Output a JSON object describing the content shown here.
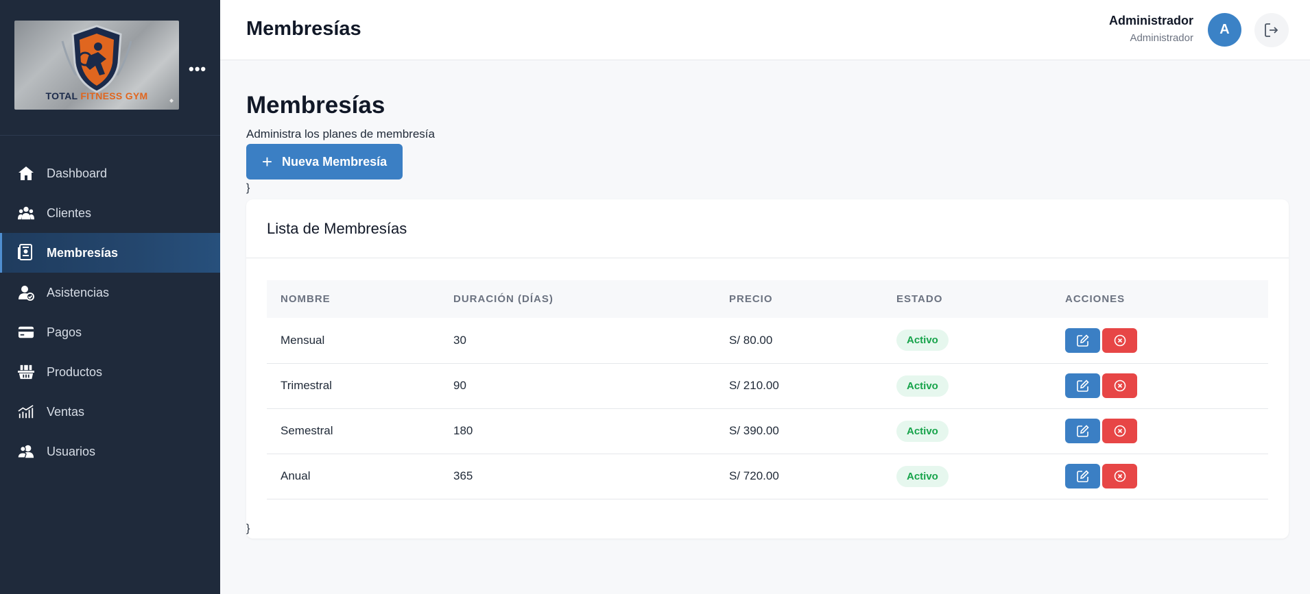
{
  "brand": {
    "logo_text_main": "TOTAL",
    "logo_text_accent": "FITNESS GYM",
    "more_label": "•••"
  },
  "sidebar": {
    "items": [
      {
        "label": "Dashboard",
        "icon": "home-icon"
      },
      {
        "label": "Clientes",
        "icon": "users-group-icon"
      },
      {
        "label": "Membresías",
        "icon": "membership-card-icon",
        "active": true
      },
      {
        "label": "Asistencias",
        "icon": "user-check-icon"
      },
      {
        "label": "Pagos",
        "icon": "credit-card-icon"
      },
      {
        "label": "Productos",
        "icon": "basket-icon"
      },
      {
        "label": "Ventas",
        "icon": "chart-line-icon"
      },
      {
        "label": "Usuarios",
        "icon": "users-icon"
      }
    ]
  },
  "header": {
    "title": "Membresías",
    "user_name": "Administrador",
    "user_role": "Administrador",
    "avatar_initial": "A"
  },
  "main": {
    "title": "Membresías",
    "subtitle": "Administra los planes de membresía",
    "new_button_label": "Nueva Membresía",
    "stray_brace": "}"
  },
  "card": {
    "title": "Lista de Membresías",
    "columns": [
      "NOMBRE",
      "DURACIÓN (DÍAS)",
      "PRECIO",
      "ESTADO",
      "ACCIONES"
    ],
    "rows": [
      {
        "nombre": "Mensual",
        "duracion": "30",
        "precio": "S/ 80.00",
        "estado": "Activo"
      },
      {
        "nombre": "Trimestral",
        "duracion": "90",
        "precio": "S/ 210.00",
        "estado": "Activo"
      },
      {
        "nombre": "Semestral",
        "duracion": "180",
        "precio": "S/ 390.00",
        "estado": "Activo"
      },
      {
        "nombre": "Anual",
        "duracion": "365",
        "precio": "S/ 720.00",
        "estado": "Activo"
      }
    ]
  },
  "colors": {
    "sidebar_bg": "#1f2a3b",
    "primary": "#3b7fc4",
    "danger": "#e74646",
    "success_text": "#16a34a",
    "success_bg": "#e6f7ee"
  }
}
